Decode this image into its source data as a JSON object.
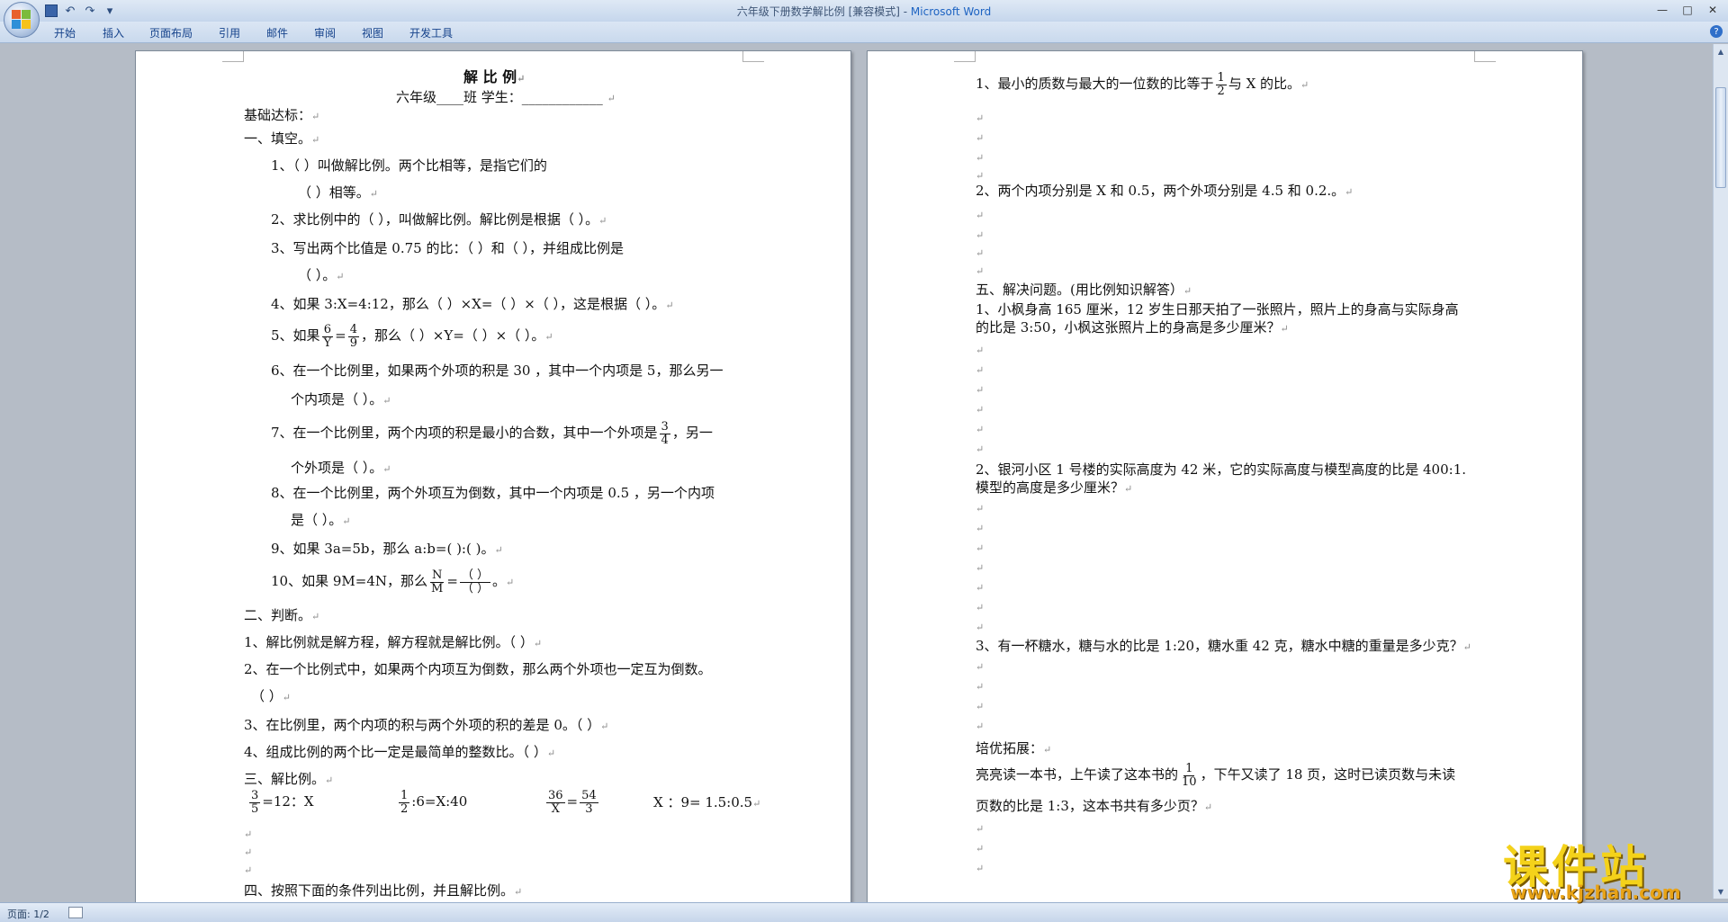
{
  "window": {
    "title_doc": "六年级下册数学解比例 [兼容模式] - ",
    "title_app": "Microsoft Word",
    "controls": [
      "—",
      "□",
      "✕"
    ]
  },
  "quick_access": {
    "undo": "↶",
    "redo": "↷",
    "more": "▾"
  },
  "ribbon": {
    "tabs": [
      "开始",
      "插入",
      "页面布局",
      "引用",
      "邮件",
      "审阅",
      "视图",
      "开发工具"
    ],
    "help": "?"
  },
  "status_bar": {
    "page": "页面: 1/2"
  },
  "watermark": {
    "text": "课件站",
    "url": "www.kjzhan.com"
  },
  "mark": "↵",
  "left_page": {
    "title": "解 比 例",
    "header_line": "六年级____班          学生：____________",
    "basic": "基础达标：",
    "sec1": "一、填空。",
    "q1a": "1、（                             ）叫做解比例。两个比相等，是指它们的",
    "q1b": "（           ）相等。",
    "q2": "2、求比例中的（              ），叫做解比例。解比例是根据（                        ）。",
    "q3a": "3、写出两个比值是  0.75  的比：（           ）和（           ），并组成比例是",
    "q3b": "（                        ）。",
    "q4": "4、如果 3:X=4:12，那么（   ）×X=（    ）×（    ），这是根据（                      ）。",
    "q5_pre": "5、如果",
    "q5_f1_num": "6",
    "q5_f1_den": "Y",
    "q5_eq": "=",
    "q5_f2_num": "4",
    "q5_f2_den": "9",
    "q5_post": "，那么（     ）×Y=（     ）×（     ）。",
    "q6a": "6、在一个比例里，如果两个外项的积是 30 ，其中一个内项是 5，那么另一",
    "q6b": "个内项是（       ）。",
    "q7a_pre": "7、在一个比例里，两个内项的积是最小的合数，其中一个外项是",
    "q7_num": "3",
    "q7_den": "4",
    "q7a_post": "，另一",
    "q7b": "个外项是（       ）。",
    "q8a": "8、在一个比例里，两个外项互为倒数，其中一个内项是  0.5 ，另一个内项",
    "q8b": "是（        ）。",
    "q9": "9、如果 3a=5b，那么 a:b=(      ):(      )。",
    "q10_pre": "10、如果 9M=4N，那么",
    "q10_f1_num": "N",
    "q10_f1_den": "M",
    "q10_eq": "=",
    "q10_f2_num": "（ ）",
    "q10_f2_den": "（ ）",
    "q10_post": "。",
    "sec2": "二、判断。",
    "j1": "1、解比例就是解方程，解方程就是解比例。（     ）",
    "j2a": "2、在一个比例式中，如果两个内项互为倒数，那么两个外项也一定互为倒数。",
    "j2b": "（     ）",
    "j3": "3、在比例里，两个内项的积与两个外项的积的差是 0。（           ）",
    "j4": "4、组成比例的两个比一定是最简单的整数比。（           ）",
    "sec3": "三、解比例。",
    "e1_num": "3",
    "e1_den": "5",
    "e1_post": "=12：X",
    "e2_num": "1",
    "e2_den": "2",
    "e2_post": ":6=X:40",
    "e3_f1_num": "36",
    "e3_f1_den": "X",
    "e3_eq": "=",
    "e3_f2_num": "54",
    "e3_f2_den": "3",
    "e4": "X  ：9= 1.5:0.5",
    "sec4": "四、按照下面的条件列出比例，并且解比例。"
  },
  "right_page": {
    "r1_pre": "1、最小的质数与最大的一位数的比等于",
    "r1_num": "1",
    "r1_den": "2",
    "r1_post": "与 X 的比。",
    "r2": "2、两个内项分别是 X 和 0.5，两个外项分别是 4.5 和 0.2.。",
    "sec5": "五、解决问题。(用比例知识解答）",
    "p1a": "1、小枫身高 165 厘米，12 岁生日那天拍了一张照片，照片上的身高与实际身高",
    "p1b": "的比是 3:50，小枫这张照片上的身高是多少厘米？",
    "p2a": "2、银河小区 1 号楼的实际高度为 42 米，它的实际高度与模型高度的比是 400:1.",
    "p2b": "模型的高度是多少厘米？",
    "p3": "3、有一杯糖水，糖与水的比是 1:20，糖水重 42 克，糖水中糖的重量是多少克？",
    "ext": "培优拓展：",
    "x1_pre": "亮亮读一本书，上午读了这本书的",
    "x1_num": "1",
    "x1_den": "10",
    "x1_post": "，下午又读了 18 页，这时已读页数与未读",
    "x2": "页数的比是 1:3，这本书共有多少页？"
  }
}
